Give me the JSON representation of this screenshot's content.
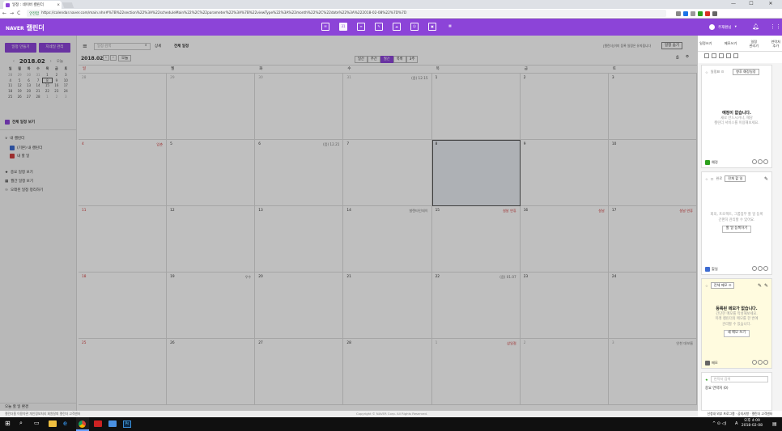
{
  "browser": {
    "tab_title": "일정 : 네이버 캘린더",
    "tab_close": "×",
    "nav": {
      "back": "←",
      "forward": "→",
      "reload": "C"
    },
    "security": "안전함",
    "url": "https://calendar.naver.com/main.nhn#%7B%22section%22%3A%22scheduleMain%22%2C%22parameter%22%3A%7B%22viewType%22%3A%22month%22%2C%22date%22%3A%222018-02-08%22%7D%7D",
    "window_controls": {
      "minimize": "—",
      "maximize": "☐",
      "close": "✕"
    }
  },
  "header": {
    "brand": "NAVER",
    "app_name": "캘린더",
    "user_name": "주재환님",
    "services": [
      "mail-icon",
      "calendar-icon",
      "list-icon",
      "note-icon",
      "cloud-icon",
      "contact-icon",
      "photo-icon",
      "more-icon"
    ],
    "accent_color": "#8c44d8"
  },
  "sidebar": {
    "btn_new_event": "일정 만들기",
    "btn_new_task": "지네일 관리",
    "mini_cal": {
      "prev": "‹",
      "next": "›",
      "title": "2018.02",
      "today": "오늘",
      "weekdays": [
        "일",
        "월",
        "화",
        "수",
        "목",
        "금",
        "토"
      ],
      "days": [
        "28",
        "29",
        "30",
        "31",
        "1",
        "2",
        "3",
        "4",
        "5",
        "6",
        "7",
        "8",
        "9",
        "10",
        "11",
        "12",
        "13",
        "14",
        "15",
        "16",
        "17",
        "18",
        "19",
        "20",
        "21",
        "22",
        "23",
        "24",
        "25",
        "26",
        "27",
        "28",
        "1",
        "2",
        "3"
      ],
      "selected_day": "8"
    },
    "all_events": "전체 일정 보기",
    "my_calendars_label": "내 캘린더",
    "calendars": [
      {
        "name": "(기본) 내 캘린더",
        "color": "#3d6bd1"
      },
      {
        "name": "내 할 일",
        "color": "#d13d3d"
      }
    ],
    "links": [
      "중요 일정 보기",
      "월간 일정 보기",
      "오래된 일정 정리하기"
    ],
    "footer": "오늘 할 일 환경"
  },
  "toolbar": {
    "search_placeholder": "일정 검색",
    "search_opt": "상세",
    "view_all": "전체 일정",
    "date": "2018.02",
    "prev": "‹",
    "next": "›",
    "today": "오늘",
    "views": [
      "일간",
      "주간",
      "월간",
      "목록",
      "3주"
    ],
    "active_view": "월간",
    "notice": "[캘린더]이미 등록 일정은 유지됩니다",
    "filter_btn": "일정 숨기",
    "print_icon": "print-icon",
    "settings_icon": "settings-icon"
  },
  "calendar": {
    "weekdays": [
      "일",
      "월",
      "화",
      "수",
      "목",
      "금",
      "토"
    ],
    "weeks": [
      [
        {
          "d": "28",
          "ev": ""
        },
        {
          "d": "29",
          "ev": ""
        },
        {
          "d": "30",
          "ev": ""
        },
        {
          "d": "31",
          "ev": "(음) 12.15"
        },
        {
          "d": "1",
          "ev": ""
        },
        {
          "d": "2",
          "ev": ""
        },
        {
          "d": "3",
          "ev": ""
        }
      ],
      [
        {
          "d": "4",
          "ev": "입춘"
        },
        {
          "d": "5",
          "ev": ""
        },
        {
          "d": "6",
          "ev": "(음) 12.21"
        },
        {
          "d": "7",
          "ev": ""
        },
        {
          "d": "8",
          "ev": ""
        },
        {
          "d": "9",
          "ev": ""
        },
        {
          "d": "10",
          "ev": ""
        }
      ],
      [
        {
          "d": "11",
          "ev": ""
        },
        {
          "d": "12",
          "ev": ""
        },
        {
          "d": "13",
          "ev": ""
        },
        {
          "d": "14",
          "ev": "발렌타인데이"
        },
        {
          "d": "15",
          "ev": "설날 연휴"
        },
        {
          "d": "16",
          "ev": "설날"
        },
        {
          "d": "17",
          "ev": "설날 연휴"
        }
      ],
      [
        {
          "d": "18",
          "ev": ""
        },
        {
          "d": "19",
          "ev": "우수"
        },
        {
          "d": "20",
          "ev": ""
        },
        {
          "d": "21",
          "ev": ""
        },
        {
          "d": "22",
          "ev": "(음) 01.07"
        },
        {
          "d": "23",
          "ev": ""
        },
        {
          "d": "24",
          "ev": ""
        }
      ],
      [
        {
          "d": "25",
          "ev": ""
        },
        {
          "d": "26",
          "ev": ""
        },
        {
          "d": "27",
          "ev": ""
        },
        {
          "d": "28",
          "ev": ""
        },
        {
          "d": "1",
          "ev": "삼일절"
        },
        {
          "d": "2",
          "ev": ""
        },
        {
          "d": "3",
          "ev": "인천 대보름"
        }
      ]
    ],
    "selected": "8",
    "holiday_color": "#d23a3a"
  },
  "right_panel": {
    "tabs": [
      "일정쓰기",
      "메모쓰기",
      "일정\n관리기",
      "연락처\n추가"
    ],
    "schedule_card": {
      "label": "일정표 ⊙",
      "select": "향후 예정일정",
      "empty_title": "예정이 없습니다.",
      "empty_body": "새로 만드시거나, 해당\n캘린더 서비스를 이용해보세요.",
      "footer": "예정"
    },
    "todo_card": {
      "label": "완료",
      "select": "전체 할 일",
      "body": "회의, 프로젝트, 그룹업무 할 일 등록\n간편히 관리할 수 있어요.",
      "btn": "할 일 등록하기",
      "footer": "할일"
    },
    "memo_card": {
      "select": "전체 메모 ⊙",
      "empty_title": "등록된 메모가 없습니다.",
      "body": "간단한 메모를 작성해보세요.\n미래 캘린더의 메모를 한 번에\n관리할 수 있습니다.",
      "btn": "새 메모 쓰기",
      "footer": "메모"
    },
    "contacts_card": {
      "search_placeholder": "연락처 검색",
      "label": "중요 연락처 (0)"
    },
    "bottom": "신청내 외부 프로그램 · 공지사항 · 캘린더 고객센터"
  },
  "footer": {
    "links": "캘린더홈  이용약관  개인정보처리  회원탈퇴  캘린더 고객센터",
    "copyright": "Copyright © NAVER Corp. All Rights Reserved."
  },
  "taskbar": {
    "time": "오후 4:09",
    "date": "2018-02-08",
    "lang": "A"
  }
}
